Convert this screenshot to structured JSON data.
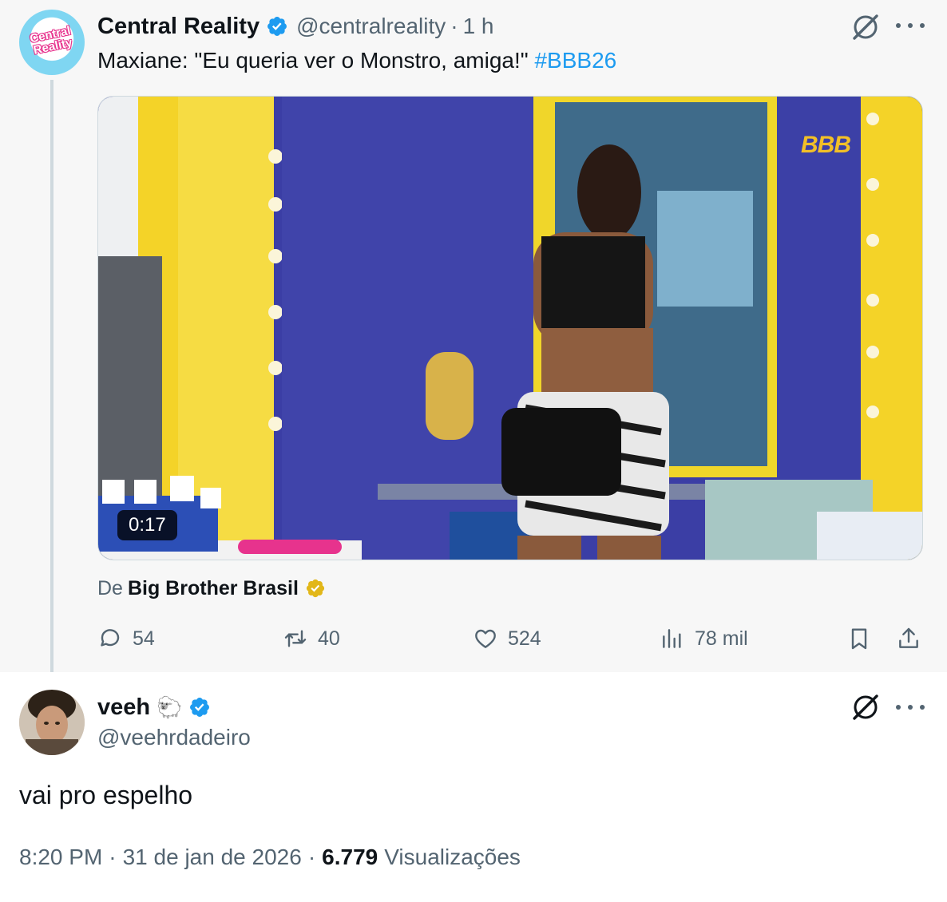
{
  "parent": {
    "author_name": "Central Reality",
    "handle": "@centralreality",
    "separator": "·",
    "time": "1 h",
    "avatar_text": "Central Reality",
    "text": "Maxiane: \"Eu queria ver o Monstro, amiga!\"",
    "hashtag": "#BBB26",
    "media": {
      "duration": "0:17",
      "watermark": "BBB"
    },
    "source_prefix": "De",
    "source_name": "Big Brother Brasil",
    "actions": {
      "replies": "54",
      "reposts": "40",
      "likes": "524",
      "views": "78 mil"
    },
    "icons": [
      "grok-icon",
      "more-icon",
      "reply-icon",
      "repost-icon",
      "like-icon",
      "views-icon",
      "bookmark-icon",
      "share-icon",
      "verified-badge-icon",
      "gold-verified-badge-icon"
    ]
  },
  "reply": {
    "author_name": "veeh",
    "emoji": "🐑",
    "handle": "@veehrdadeiro",
    "text": "vai pro espelho",
    "time": "8:20 PM",
    "separator": "·",
    "date": "31 de jan de 2026",
    "views_count": "6.779",
    "views_label": "Visualizações"
  },
  "colors": {
    "accent": "#1d9bf0",
    "muted": "#536471",
    "text": "#0f1419",
    "parent_bg": "#f7f7f7",
    "gold": "#e2b719"
  }
}
